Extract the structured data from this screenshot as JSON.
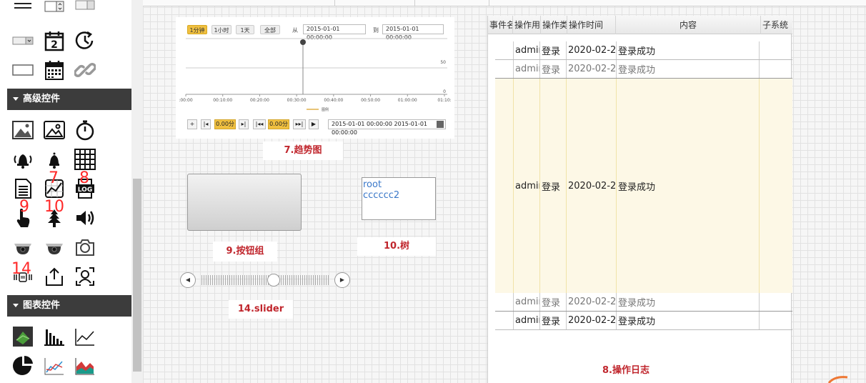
{
  "palette": {
    "group_advanced": "高级控件",
    "group_chart": "图表控件",
    "markers": {
      "m7": "7",
      "m8": "8",
      "m9": "9",
      "m10": "10",
      "m14": "14"
    },
    "calendar_day": "2",
    "log_badge": "LOG",
    "icons": [
      "list-icon",
      "stepper-icon",
      "dropdown-icon",
      "switch-icon",
      "calendar-day-icon",
      "clock-icon",
      "textbox-icon",
      "calendar-icon",
      "link-icon",
      "picture-icon",
      "image-icon",
      "stopwatch-icon",
      "alarm-icon",
      "bell-icon",
      "grid-icon",
      "document-icon",
      "trend-icon",
      "log-icon",
      "button-hand-icon",
      "tree-icon",
      "speaker-icon",
      "camera-dome-icon",
      "camera-dome-2-icon",
      "camera-icon",
      "slider-icon",
      "share-icon",
      "face-icon",
      "3d-chart-icon",
      "bar-chart-icon",
      "line-chart-icon",
      "pie-chart-icon",
      "multi-line-chart-icon",
      "area-chart-icon"
    ]
  },
  "trend": {
    "ranges": [
      "1分钟",
      "1小时",
      "1天",
      "全部"
    ],
    "from_label": "从",
    "to_label": "到",
    "from_value": "2015-01-01  00:00:00",
    "to_value": "2015-01-01  00:00:00",
    "y_ticks": [
      "50",
      "0"
    ],
    "x_ticks": [
      ":00:00",
      "00:10:00",
      "00:20:00",
      "00:30:00",
      "00:40:00",
      "00:50:00",
      "01:00:00",
      "01:10:"
    ],
    "legend": "图例",
    "step_a": "0.00分",
    "step_b": "0.00分",
    "range_value": "2015-01-01  00:00:00   2015-01-01  00:00:00",
    "caption": "7.趋势图"
  },
  "button_group": {
    "caption": "9.按钮组"
  },
  "tree": {
    "items": [
      "root",
      "cccccc2"
    ],
    "caption": "10.树"
  },
  "slider": {
    "caption": "14.slider",
    "value": 0.57
  },
  "log": {
    "columns": [
      "事件名",
      "操作用",
      "操作类",
      "操作时间",
      "内容",
      "子系统"
    ],
    "rows": [
      {
        "user": "admin",
        "type": "登录",
        "time": "2020-02-2",
        "content": "登录成功",
        "state": "normal"
      },
      {
        "user": "admin",
        "type": "登录",
        "time": "2020-02-2",
        "content": "登录成功",
        "state": "dim"
      },
      {
        "user": "admin",
        "type": "登录",
        "time": "2020-02-2",
        "content": "登录成功",
        "state": "selected"
      },
      {
        "user": "admin",
        "type": "登录",
        "time": "2020-02-2",
        "content": "登录成功",
        "state": "dim"
      },
      {
        "user": "admin",
        "type": "登录",
        "time": "2020-02-2",
        "content": "登录成功",
        "state": "normal"
      }
    ],
    "caption": "8.操作日志"
  }
}
